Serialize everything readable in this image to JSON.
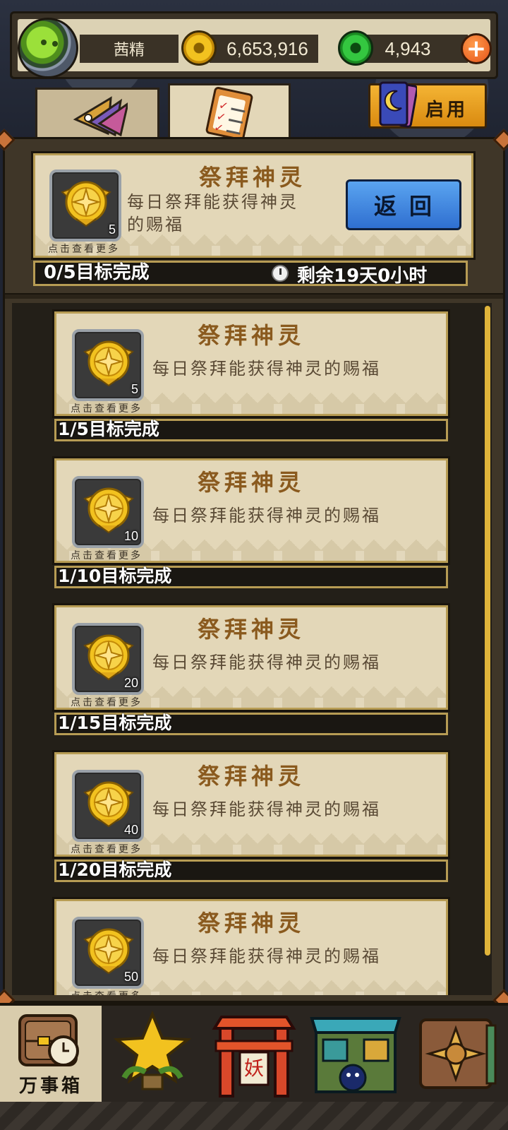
{
  "player": {
    "name": "茜精",
    "gold": "6,653,916",
    "jade": "4,943"
  },
  "icons": {
    "avatar": "green-frog-avatar-icon",
    "gold": "gold-coin-icon",
    "jade": "jade-coin-icon",
    "plus": "plus-icon",
    "tab_1": "flags-icon",
    "tab_2": "clipboard-checklist-icon",
    "enable": "moon-card-icon",
    "badge": "gold-star-medal-icon",
    "clock": "stopwatch-icon"
  },
  "tabs": {
    "enable_label": "启用"
  },
  "header": {
    "title": "祭拜神灵",
    "description_line1": "每日祭拜能获得神灵",
    "description_line2": "的赐福",
    "badge_count": "5",
    "more_tip": "点击查看更多",
    "back_label": "返回",
    "progress": "0/5目标完成",
    "remaining": "剩余19天0小时"
  },
  "items": [
    {
      "title": "祭拜神灵",
      "description": "每日祭拜能获得神灵的赐福",
      "badge_count": "5",
      "more_tip": "点击查看更多",
      "progress": "1/5目标完成"
    },
    {
      "title": "祭拜神灵",
      "description": "每日祭拜能获得神灵的赐福",
      "badge_count": "10",
      "more_tip": "点击查看更多",
      "progress": "1/10目标完成"
    },
    {
      "title": "祭拜神灵",
      "description": "每日祭拜能获得神灵的赐福",
      "badge_count": "20",
      "more_tip": "点击查看更多",
      "progress": "1/15目标完成"
    },
    {
      "title": "祭拜神灵",
      "description": "每日祭拜能获得神灵的赐福",
      "badge_count": "40",
      "more_tip": "点击查看更多",
      "progress": "1/20目标完成"
    },
    {
      "title": "祭拜神灵",
      "description": "每日祭拜能获得神灵的赐福",
      "badge_count": "50",
      "more_tip": "点击查看更多"
    }
  ],
  "bottom_nav": {
    "active_label": "万事箱",
    "items": [
      {
        "icon": "treasure-chest-clock-icon"
      },
      {
        "icon": "star-trophy-icon"
      },
      {
        "icon": "demon-gate-icon"
      },
      {
        "icon": "market-stall-icon"
      },
      {
        "icon": "book-compass-icon"
      }
    ],
    "gate_sign": "妖"
  },
  "colors": {
    "panel": "#3f3628",
    "card": "#e3d7b8",
    "title": "#8a5a1e",
    "accent_gold": "#f2c21f",
    "back_button": "#3f86e0"
  }
}
